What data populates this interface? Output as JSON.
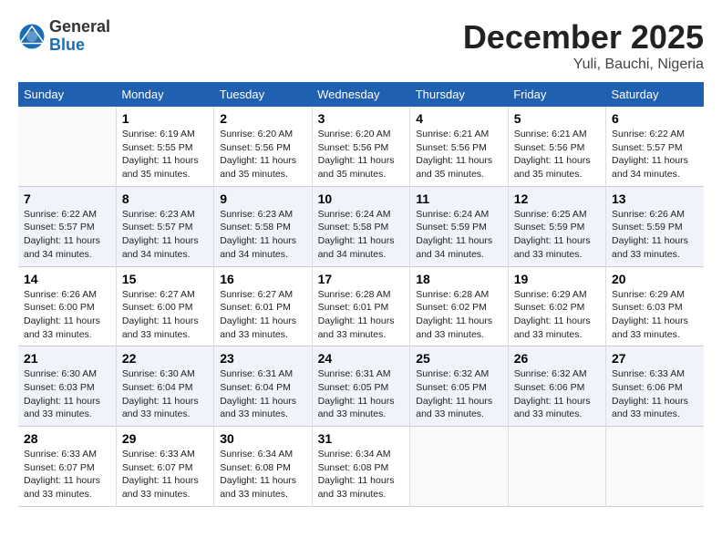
{
  "logo": {
    "general": "General",
    "blue": "Blue"
  },
  "title": "December 2025",
  "location": "Yuli, Bauchi, Nigeria",
  "days_of_week": [
    "Sunday",
    "Monday",
    "Tuesday",
    "Wednesday",
    "Thursday",
    "Friday",
    "Saturday"
  ],
  "weeks": [
    [
      {
        "day": "",
        "sunrise": "",
        "sunset": "",
        "daylight": ""
      },
      {
        "day": "1",
        "sunrise": "Sunrise: 6:19 AM",
        "sunset": "Sunset: 5:55 PM",
        "daylight": "Daylight: 11 hours and 35 minutes."
      },
      {
        "day": "2",
        "sunrise": "Sunrise: 6:20 AM",
        "sunset": "Sunset: 5:56 PM",
        "daylight": "Daylight: 11 hours and 35 minutes."
      },
      {
        "day": "3",
        "sunrise": "Sunrise: 6:20 AM",
        "sunset": "Sunset: 5:56 PM",
        "daylight": "Daylight: 11 hours and 35 minutes."
      },
      {
        "day": "4",
        "sunrise": "Sunrise: 6:21 AM",
        "sunset": "Sunset: 5:56 PM",
        "daylight": "Daylight: 11 hours and 35 minutes."
      },
      {
        "day": "5",
        "sunrise": "Sunrise: 6:21 AM",
        "sunset": "Sunset: 5:56 PM",
        "daylight": "Daylight: 11 hours and 35 minutes."
      },
      {
        "day": "6",
        "sunrise": "Sunrise: 6:22 AM",
        "sunset": "Sunset: 5:57 PM",
        "daylight": "Daylight: 11 hours and 34 minutes."
      }
    ],
    [
      {
        "day": "7",
        "sunrise": "Sunrise: 6:22 AM",
        "sunset": "Sunset: 5:57 PM",
        "daylight": "Daylight: 11 hours and 34 minutes."
      },
      {
        "day": "8",
        "sunrise": "Sunrise: 6:23 AM",
        "sunset": "Sunset: 5:57 PM",
        "daylight": "Daylight: 11 hours and 34 minutes."
      },
      {
        "day": "9",
        "sunrise": "Sunrise: 6:23 AM",
        "sunset": "Sunset: 5:58 PM",
        "daylight": "Daylight: 11 hours and 34 minutes."
      },
      {
        "day": "10",
        "sunrise": "Sunrise: 6:24 AM",
        "sunset": "Sunset: 5:58 PM",
        "daylight": "Daylight: 11 hours and 34 minutes."
      },
      {
        "day": "11",
        "sunrise": "Sunrise: 6:24 AM",
        "sunset": "Sunset: 5:59 PM",
        "daylight": "Daylight: 11 hours and 34 minutes."
      },
      {
        "day": "12",
        "sunrise": "Sunrise: 6:25 AM",
        "sunset": "Sunset: 5:59 PM",
        "daylight": "Daylight: 11 hours and 33 minutes."
      },
      {
        "day": "13",
        "sunrise": "Sunrise: 6:26 AM",
        "sunset": "Sunset: 5:59 PM",
        "daylight": "Daylight: 11 hours and 33 minutes."
      }
    ],
    [
      {
        "day": "14",
        "sunrise": "Sunrise: 6:26 AM",
        "sunset": "Sunset: 6:00 PM",
        "daylight": "Daylight: 11 hours and 33 minutes."
      },
      {
        "day": "15",
        "sunrise": "Sunrise: 6:27 AM",
        "sunset": "Sunset: 6:00 PM",
        "daylight": "Daylight: 11 hours and 33 minutes."
      },
      {
        "day": "16",
        "sunrise": "Sunrise: 6:27 AM",
        "sunset": "Sunset: 6:01 PM",
        "daylight": "Daylight: 11 hours and 33 minutes."
      },
      {
        "day": "17",
        "sunrise": "Sunrise: 6:28 AM",
        "sunset": "Sunset: 6:01 PM",
        "daylight": "Daylight: 11 hours and 33 minutes."
      },
      {
        "day": "18",
        "sunrise": "Sunrise: 6:28 AM",
        "sunset": "Sunset: 6:02 PM",
        "daylight": "Daylight: 11 hours and 33 minutes."
      },
      {
        "day": "19",
        "sunrise": "Sunrise: 6:29 AM",
        "sunset": "Sunset: 6:02 PM",
        "daylight": "Daylight: 11 hours and 33 minutes."
      },
      {
        "day": "20",
        "sunrise": "Sunrise: 6:29 AM",
        "sunset": "Sunset: 6:03 PM",
        "daylight": "Daylight: 11 hours and 33 minutes."
      }
    ],
    [
      {
        "day": "21",
        "sunrise": "Sunrise: 6:30 AM",
        "sunset": "Sunset: 6:03 PM",
        "daylight": "Daylight: 11 hours and 33 minutes."
      },
      {
        "day": "22",
        "sunrise": "Sunrise: 6:30 AM",
        "sunset": "Sunset: 6:04 PM",
        "daylight": "Daylight: 11 hours and 33 minutes."
      },
      {
        "day": "23",
        "sunrise": "Sunrise: 6:31 AM",
        "sunset": "Sunset: 6:04 PM",
        "daylight": "Daylight: 11 hours and 33 minutes."
      },
      {
        "day": "24",
        "sunrise": "Sunrise: 6:31 AM",
        "sunset": "Sunset: 6:05 PM",
        "daylight": "Daylight: 11 hours and 33 minutes."
      },
      {
        "day": "25",
        "sunrise": "Sunrise: 6:32 AM",
        "sunset": "Sunset: 6:05 PM",
        "daylight": "Daylight: 11 hours and 33 minutes."
      },
      {
        "day": "26",
        "sunrise": "Sunrise: 6:32 AM",
        "sunset": "Sunset: 6:06 PM",
        "daylight": "Daylight: 11 hours and 33 minutes."
      },
      {
        "day": "27",
        "sunrise": "Sunrise: 6:33 AM",
        "sunset": "Sunset: 6:06 PM",
        "daylight": "Daylight: 11 hours and 33 minutes."
      }
    ],
    [
      {
        "day": "28",
        "sunrise": "Sunrise: 6:33 AM",
        "sunset": "Sunset: 6:07 PM",
        "daylight": "Daylight: 11 hours and 33 minutes."
      },
      {
        "day": "29",
        "sunrise": "Sunrise: 6:33 AM",
        "sunset": "Sunset: 6:07 PM",
        "daylight": "Daylight: 11 hours and 33 minutes."
      },
      {
        "day": "30",
        "sunrise": "Sunrise: 6:34 AM",
        "sunset": "Sunset: 6:08 PM",
        "daylight": "Daylight: 11 hours and 33 minutes."
      },
      {
        "day": "31",
        "sunrise": "Sunrise: 6:34 AM",
        "sunset": "Sunset: 6:08 PM",
        "daylight": "Daylight: 11 hours and 33 minutes."
      },
      {
        "day": "",
        "sunrise": "",
        "sunset": "",
        "daylight": ""
      },
      {
        "day": "",
        "sunrise": "",
        "sunset": "",
        "daylight": ""
      },
      {
        "day": "",
        "sunrise": "",
        "sunset": "",
        "daylight": ""
      }
    ]
  ]
}
